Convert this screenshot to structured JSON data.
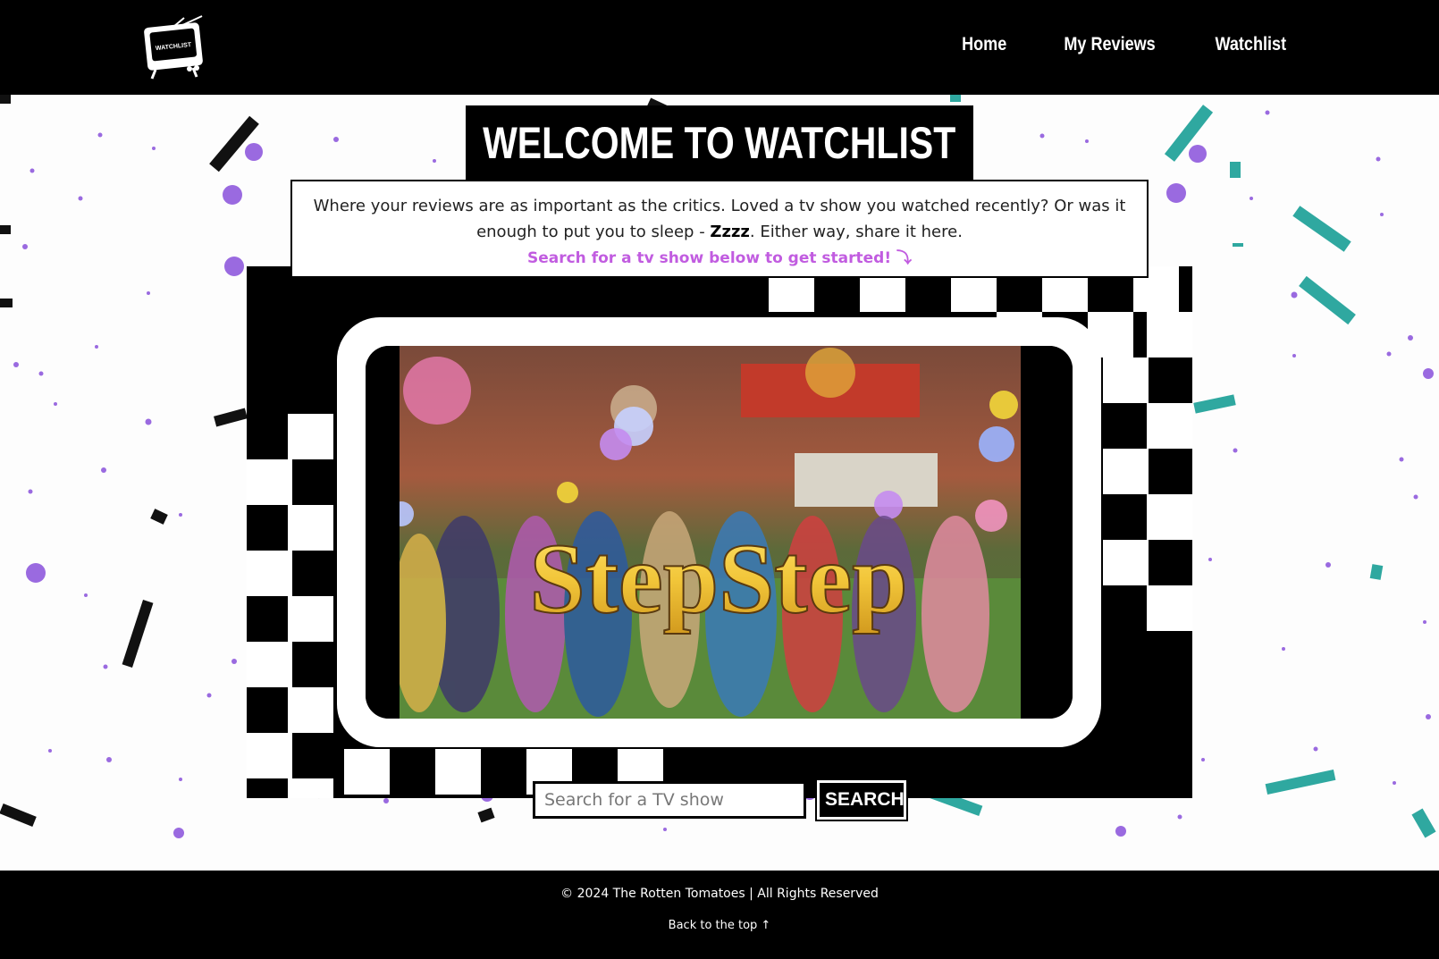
{
  "colors": {
    "background": "#fdfdfd",
    "black": "#000000",
    "accent_purple": "#c15ce0",
    "confetti_purple": "#9a6ae0",
    "confetti_teal": "#2fa8a0",
    "title_gold": "#f2c63a"
  },
  "header": {
    "logo_text": "WATCHLIST",
    "nav": [
      {
        "label": "Home"
      },
      {
        "label": "My Reviews"
      },
      {
        "label": "Watchlist"
      }
    ]
  },
  "hero": {
    "title": "WELCOME TO WATCHLIST",
    "intro_part1": "Where your reviews are as important as the critics. Loved a tv show you watched recently? Or was it enough to put you to sleep - ",
    "intro_emphasis": "Zzzz",
    "intro_part2": ". Either way, share it here.",
    "cta": "Search for a tv show below to get started! ⤵",
    "tv_image_title": "StepStep"
  },
  "search": {
    "placeholder": "Search for a TV show",
    "value": "",
    "button_label": "SEARCH"
  },
  "footer": {
    "copyright": "© 2024 The Rotten Tomatoes | All Rights Reserved",
    "back_to_top": "Back to the top ↑"
  }
}
